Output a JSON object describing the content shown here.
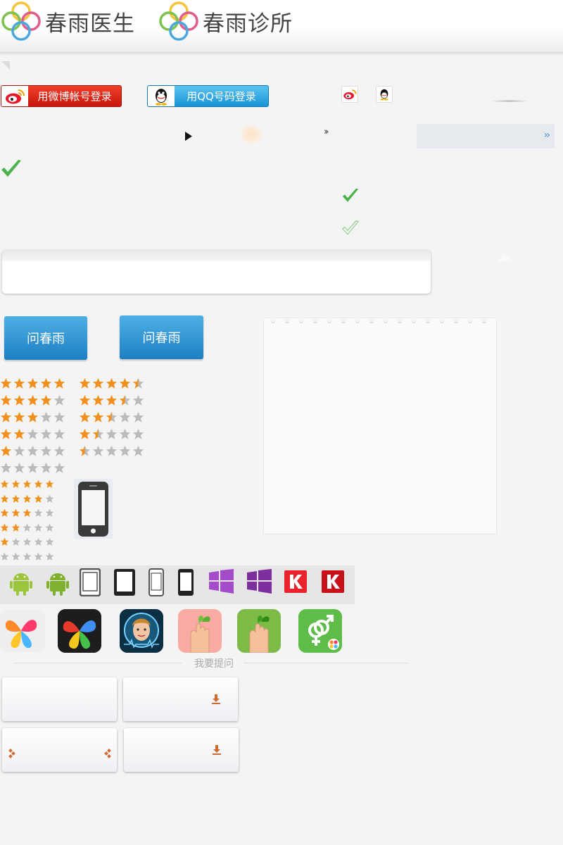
{
  "header": {
    "brand1": "春雨医生",
    "brand2": "春雨诊所"
  },
  "login": {
    "weibo_label": "用微博帐号登录",
    "qq_label": "用QQ号码登录"
  },
  "ask": {
    "button1": "问春雨",
    "button2": "问春雨"
  },
  "ratings": {
    "left_column": [
      5,
      4,
      3,
      2,
      1,
      0
    ],
    "right_column": [
      4.5,
      3.5,
      2.5,
      1.5,
      0.5
    ],
    "small_column": [
      5,
      4,
      3,
      2,
      1,
      0
    ]
  },
  "platforms": [
    "android-icon",
    "android-icon",
    "tablet-icon",
    "tablet-icon",
    "phone-icon",
    "phone-icon",
    "windows-icon",
    "windows-icon",
    "k-icon",
    "k-icon"
  ],
  "apps": [
    "clover-app-icon",
    "go-launcher-icon",
    "face-app-icon",
    "hand-sprout-pink-icon",
    "hand-sprout-green-icon",
    "gender-app-icon"
  ],
  "divider": {
    "label": "我要提问"
  },
  "colors": {
    "weibo_red": "#d81e06",
    "qq_blue": "#1a93d6",
    "ask_blue": "#2a8fd2",
    "star_orange": "#f0901e",
    "star_gray": "#bbbbbb",
    "check_green": "#4bb34b"
  }
}
